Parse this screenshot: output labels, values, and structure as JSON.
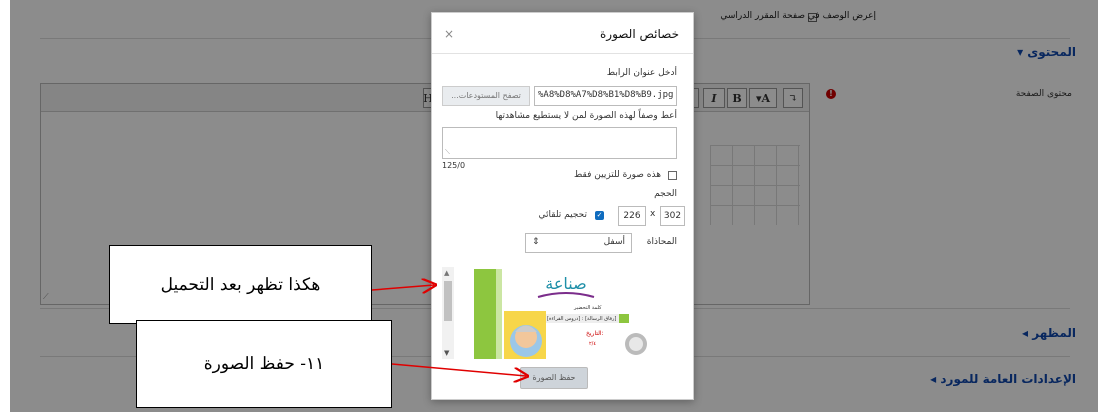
{
  "background": {
    "show_desc_label": "إعرض الوصف في صفحة المقرر الدراسي",
    "content_section": "المحتوى",
    "page_content_label": "محتوى الصفحة",
    "appearance_section": "المظهر",
    "general_settings_section": "الإعدادات العامة للمورد",
    "toolbar": {
      "bold": "B",
      "italic": "I",
      "font_color": "A",
      "undo": "↴",
      "align": "≡",
      "extra": "H"
    }
  },
  "dialog": {
    "title": "خصائص الصورة",
    "close": "×",
    "url_label": "أدخل عنوان الرابط",
    "url_value": "%A8%D8%A7%D8%B1%D8%B9.jpg",
    "browse_button": "تصفح المستودعات...",
    "alt_label": "أعط وصفاً لهذه الصورة لمن لا يستطيع مشاهدتها",
    "alt_counter": "125/0",
    "decorative_label": "هذه صورة للتزيين فقط",
    "size_label": "الحجم",
    "width": "302",
    "height": "226",
    "size_sep": "x",
    "auto_size_label": "تحجيم تلقائي",
    "align_label": "المحاذاة",
    "align_value": "أسفل",
    "save_button": "حفظ الصورة",
    "image_texts": {
      "brand": "صناعة",
      "line1": "كلمة التحضير",
      "line2": "[دروس القراءة] : [رفاق الرسالة]",
      "line3": "التاريخ:",
      "line4": "٢/٤"
    }
  },
  "callouts": {
    "after_upload": "هكذا تظهر بعد التحميل",
    "save_image": "١١- حفظ الصورة"
  },
  "colors": {
    "accent": "#0f47ad",
    "arrow": "#e00000",
    "primary_check": "#0f6cbf"
  }
}
